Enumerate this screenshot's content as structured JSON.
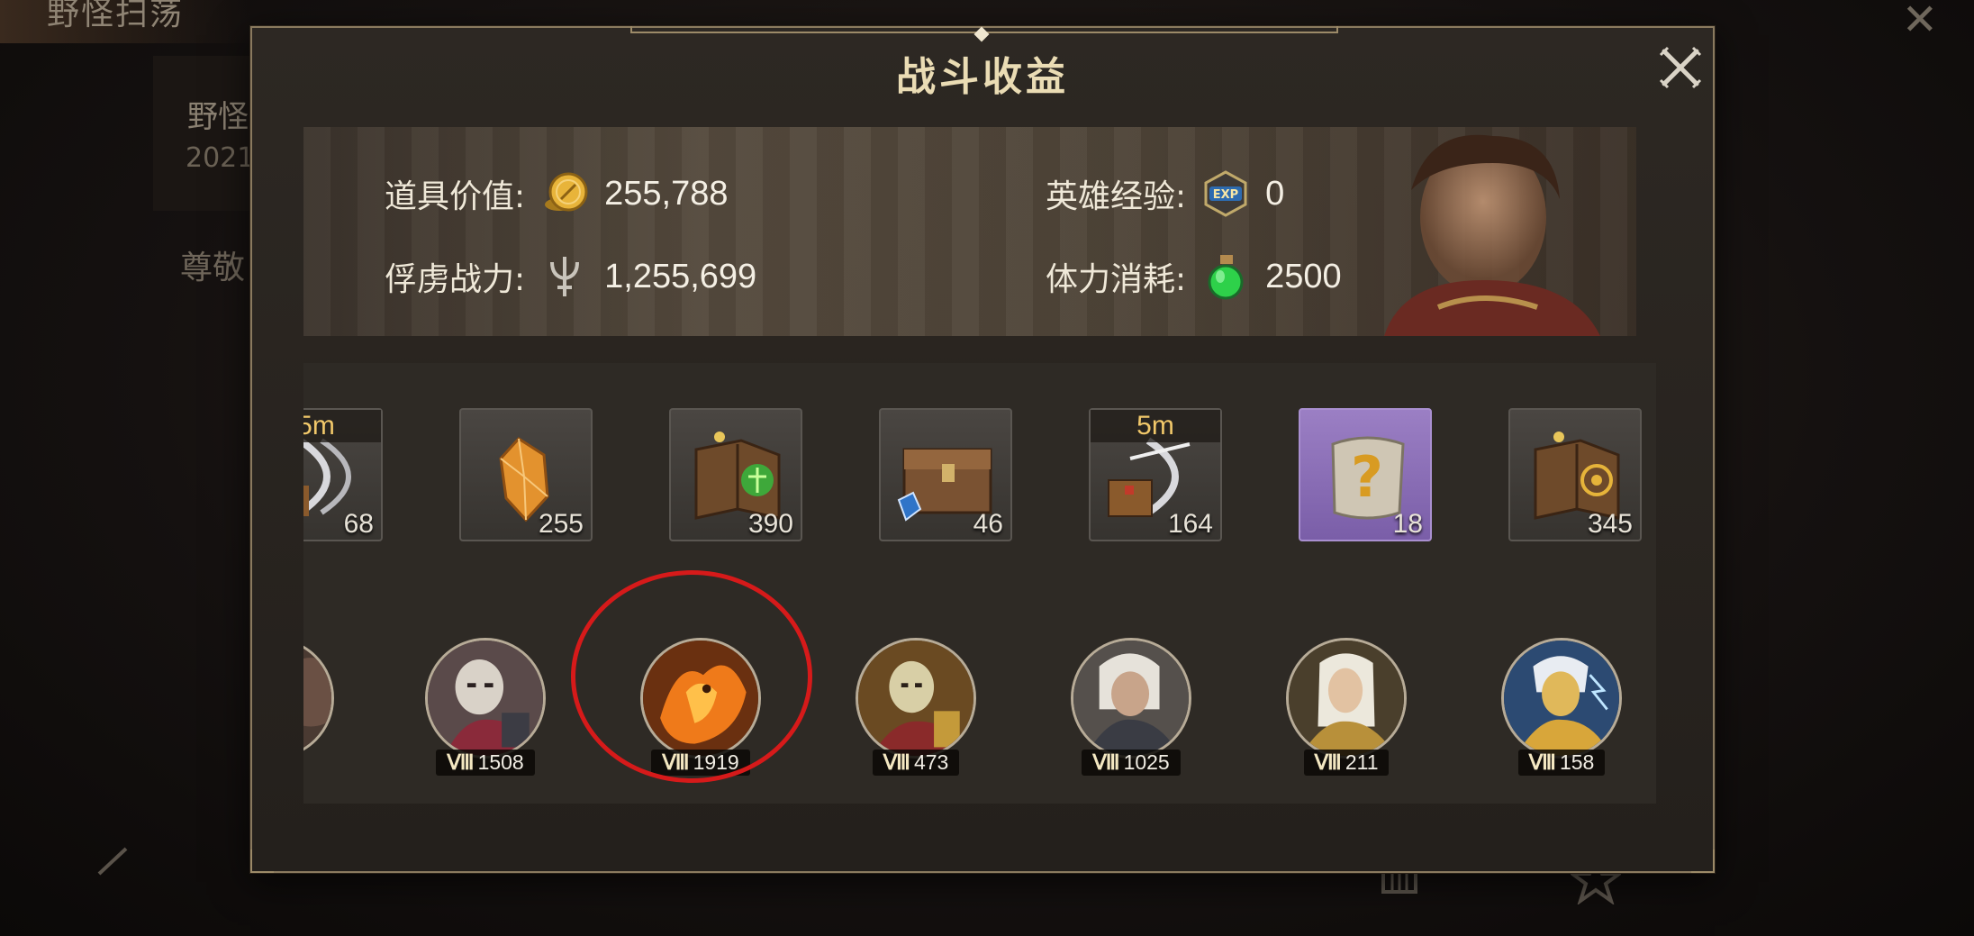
{
  "background": {
    "title": "野怪扫荡",
    "card_line1": "野怪",
    "card_line2": "2021",
    "greeting": "尊敬"
  },
  "dialog": {
    "title": "战斗收益",
    "close_icon": "close-icon"
  },
  "summary": {
    "item_value_label": "道具价值:",
    "item_value": "255,788",
    "hero_exp_label": "英雄经验:",
    "hero_exp": "0",
    "captive_power_label": "俘虏战力:",
    "captive_power": "1,255,699",
    "stamina_label": "体力消耗:",
    "stamina_cost": "2500",
    "icons": [
      "gold-coin-icon",
      "exp-badge-icon",
      "trident-icon",
      "potion-icon"
    ]
  },
  "items": [
    {
      "name": "bow-box",
      "tag": "5m",
      "count": "68",
      "partial": true
    },
    {
      "name": "crystal",
      "tag": "",
      "count": "255"
    },
    {
      "name": "green-tome",
      "tag": "",
      "count": "390"
    },
    {
      "name": "wooden-chest",
      "tag": "",
      "count": "46"
    },
    {
      "name": "bow-box",
      "tag": "5m",
      "count": "164"
    },
    {
      "name": "mystery-scroll",
      "tag": "",
      "count": "18",
      "purple": true
    },
    {
      "name": "gold-tome",
      "tag": "",
      "count": "345"
    }
  ],
  "heroes": [
    {
      "rank": "Ⅷ",
      "count": "1508"
    },
    {
      "rank": "Ⅷ",
      "count": "1919",
      "highlighted": true
    },
    {
      "rank": "Ⅷ",
      "count": "473"
    },
    {
      "rank": "Ⅷ",
      "count": "1025"
    },
    {
      "rank": "Ⅷ",
      "count": "211"
    },
    {
      "rank": "Ⅷ",
      "count": "158"
    }
  ],
  "colors": {
    "title": "#eadcb4",
    "highlight": "#d61a1a",
    "purple_slot": "#8a6cb8"
  }
}
